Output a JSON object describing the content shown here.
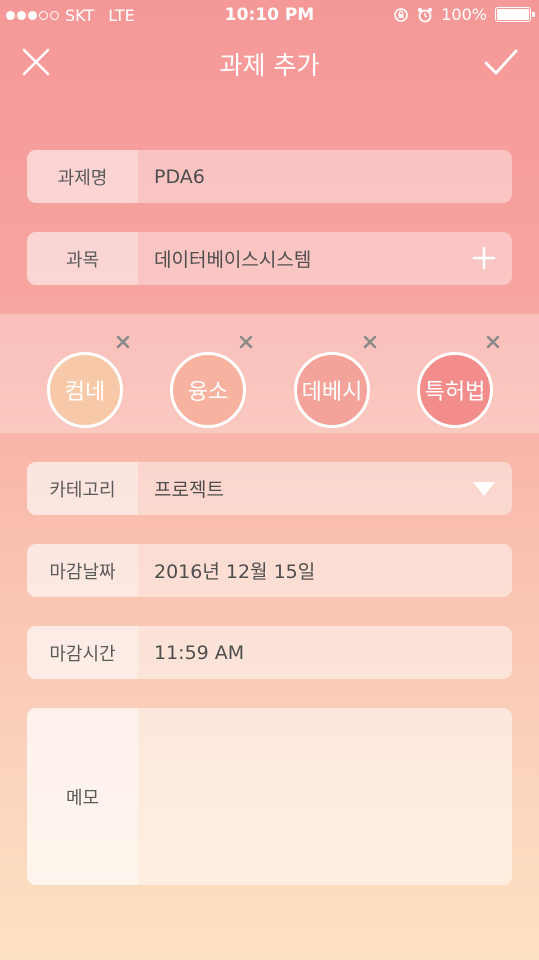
{
  "status_bar": {
    "carrier": "SKT",
    "network": "LTE",
    "time": "10:10 PM",
    "battery": "100%"
  },
  "nav": {
    "title": "과제 추가"
  },
  "form": {
    "name": {
      "label": "과제명",
      "value": "PDA6"
    },
    "subject": {
      "label": "과목",
      "value": "데이터베이스시스템"
    },
    "category": {
      "label": "카테고리",
      "value": "프로젝트"
    },
    "due_date": {
      "label": "마감날짜",
      "value": "2016년 12월 15일"
    },
    "due_time": {
      "label": "마감시간",
      "value": "11:59 AM"
    },
    "memo": {
      "label": "메모",
      "value": ""
    }
  },
  "subject_chips": [
    {
      "label": "컴네",
      "color": "#f7c9a8"
    },
    {
      "label": "융소",
      "color": "#f7b3a0"
    },
    {
      "label": "데베시",
      "color": "#f4a39a"
    },
    {
      "label": "특허법",
      "color": "#f28d8c"
    }
  ],
  "colors": {
    "gradient_top": "#f59898",
    "gradient_bottom": "#fde2c2",
    "chip_remove": "#8a8a8a"
  }
}
